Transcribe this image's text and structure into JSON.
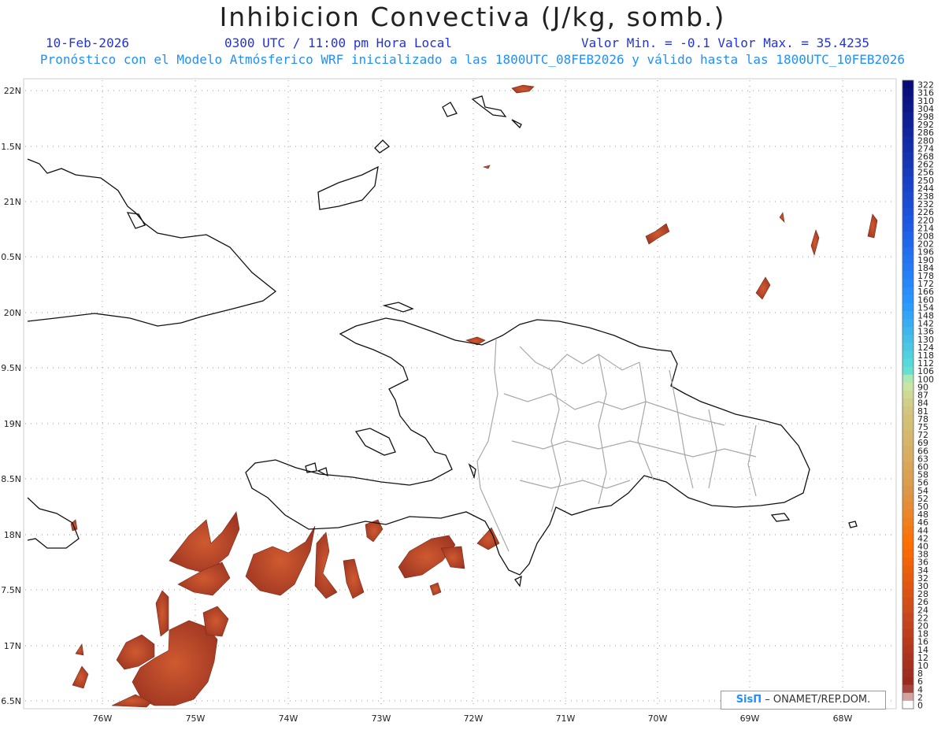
{
  "header": {
    "title": "Inhibicion Convectiva (J/kg, somb.)",
    "date": "10-Feb-2026",
    "time": "0300 UTC / 11:00 pm Hora Local",
    "minmax": "Valor Min. = -0.1  Valor Max. = 35.4235",
    "forecast": "Pronóstico con el Modelo Atmósferico WRF inicializado a las 1800UTC_08FEB2026 y válido hasta las  1800UTC_10FEB2026"
  },
  "credit": {
    "brand": "SisΠ",
    "org": "– ONAMET/REP.DOM."
  },
  "map": {
    "lon_labels": [
      "76W",
      "75W",
      "74W",
      "73W",
      "72W",
      "71W",
      "70W",
      "69W",
      "68W"
    ],
    "lat_labels": [
      "22N",
      "1.5N",
      "21N",
      "0.5N",
      "20N",
      "9.5N",
      "19N",
      "8.5N",
      "18N",
      "7.5N",
      "17N",
      "6.5N"
    ]
  },
  "colorbar": {
    "labels": [
      "322",
      "316",
      "310",
      "304",
      "298",
      "292",
      "286",
      "280",
      "274",
      "268",
      "262",
      "256",
      "250",
      "244",
      "238",
      "232",
      "226",
      "220",
      "214",
      "208",
      "202",
      "196",
      "190",
      "184",
      "178",
      "172",
      "166",
      "160",
      "154",
      "148",
      "142",
      "136",
      "130",
      "124",
      "118",
      "112",
      "106",
      "100",
      "90",
      "87",
      "84",
      "81",
      "78",
      "75",
      "72",
      "69",
      "66",
      "63",
      "60",
      "58",
      "56",
      "54",
      "52",
      "50",
      "48",
      "46",
      "44",
      "42",
      "40",
      "38",
      "36",
      "34",
      "32",
      "30",
      "28",
      "26",
      "24",
      "22",
      "20",
      "18",
      "16",
      "14",
      "12",
      "10",
      "8",
      "6",
      "4",
      "2",
      "0"
    ]
  },
  "colors": {
    "shade": "#a33a24",
    "shade_light": "#c4542c",
    "blue_top": "#0b0b78",
    "blue_mid": "#1e6fff",
    "cyan": "#5ce0d6",
    "tan": "#c9bb7a",
    "orange": "#ff6a00",
    "brown": "#9a2a1e"
  }
}
